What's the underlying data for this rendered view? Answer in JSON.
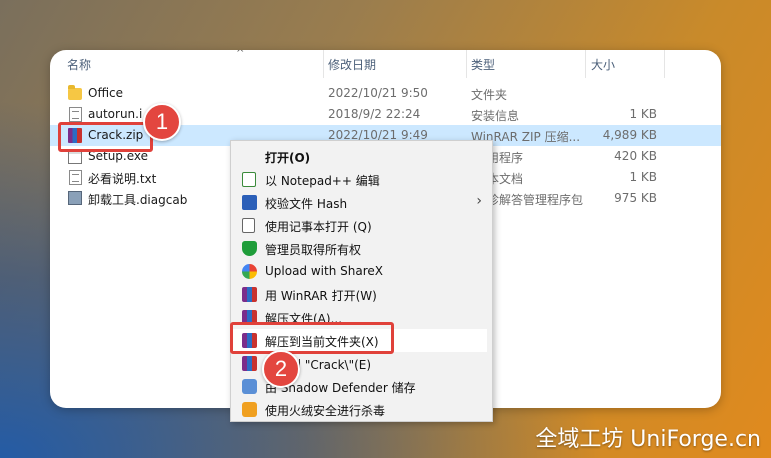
{
  "columns": {
    "name": "名称",
    "modified": "修改日期",
    "type": "类型",
    "size": "大小"
  },
  "files": [
    {
      "name": "Office",
      "modified": "2022/10/21 9:50",
      "type": "文件夹",
      "size": "",
      "icon": "folder-icon"
    },
    {
      "name": "autorun.inf",
      "modified": "2018/9/2 22:24",
      "type": "安装信息",
      "size": "1 KB",
      "icon": "settings-file-icon"
    },
    {
      "name": "Crack.zip",
      "modified": "2022/10/21 9:49",
      "type": "WinRAR ZIP 压缩...",
      "size": "4,989 KB",
      "icon": "winrar-icon"
    },
    {
      "name": "Setup.exe",
      "modified": "",
      "type": "用程序",
      "size": "420 KB",
      "icon": "exe-icon"
    },
    {
      "name": "必看说明.txt",
      "modified": "",
      "type": "本文档",
      "size": "1 KB",
      "icon": "text-file-icon"
    },
    {
      "name": "卸载工具.diagcab",
      "modified": "",
      "type": "诊解答管理程序包",
      "size": "975 KB",
      "icon": "diagcab-icon"
    }
  ],
  "context_menu": {
    "items": [
      {
        "label": "打开(O)",
        "icon": "",
        "bold": true
      },
      {
        "label": "以 Notepad++ 编辑",
        "icon": "notepad-plus-icon"
      },
      {
        "label": "校验文件 Hash",
        "icon": "hash-icon",
        "submenu": true
      },
      {
        "label": "使用记事本打开 (Q)",
        "icon": "notepad-icon"
      },
      {
        "label": "管理员取得所有权",
        "icon": "shield-icon"
      },
      {
        "label": "Upload with ShareX",
        "icon": "sharex-icon"
      },
      {
        "label": "用 WinRAR 打开(W)",
        "icon": "winrar-icon"
      },
      {
        "label": "解压文件(A)...",
        "icon": "winrar-icon"
      },
      {
        "label": "解压到当前文件夹(X)",
        "icon": "winrar-icon"
      },
      {
        "label": "到 \"Crack\\\"(E)",
        "icon": "winrar-icon"
      },
      {
        "label": "由 Shadow Defender 储存",
        "icon": "shadow-defender-icon"
      },
      {
        "label": "使用火绒安全进行杀毒",
        "icon": "huorong-icon"
      }
    ]
  },
  "annotations": {
    "step1": "1",
    "step2": "2"
  },
  "watermark": "全域工坊 UniForge.cn",
  "colors": {
    "highlight_red": "#e0413a",
    "selection": "#cce8ff",
    "menu_bg": "#f2f2f2"
  }
}
